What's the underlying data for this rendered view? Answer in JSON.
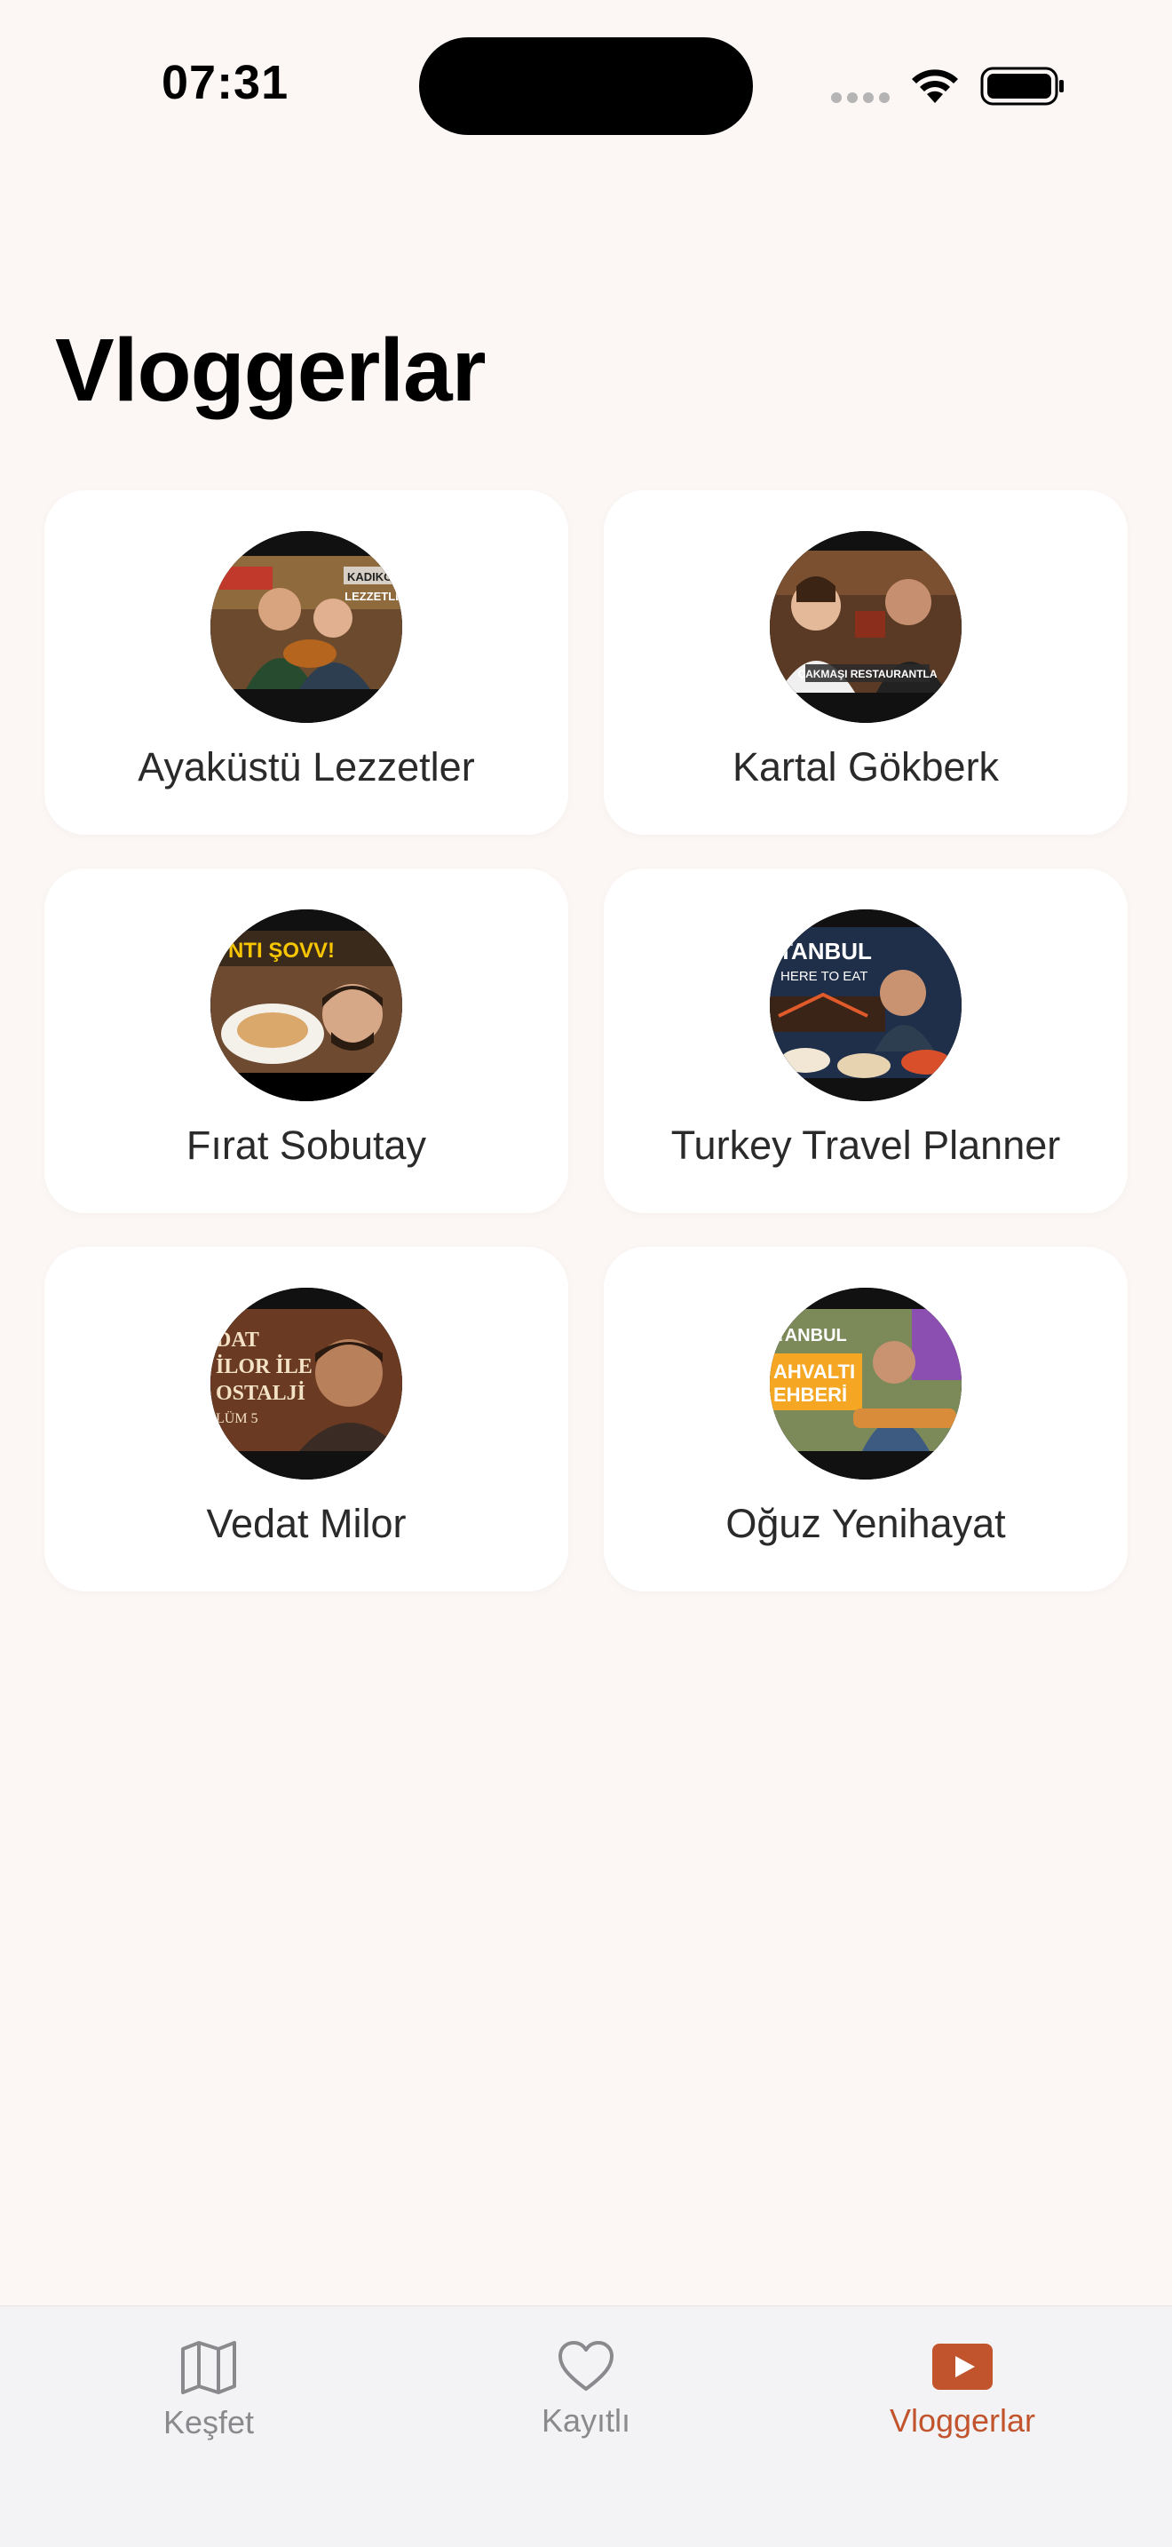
{
  "status_bar": {
    "time": "07:31"
  },
  "page": {
    "title": "Vloggerlar"
  },
  "vloggers": [
    {
      "name": "Ayaküstü Lezzetler",
      "thumb_text": "KADIKÖY LEZZETLER"
    },
    {
      "name": "Kartal Gökberk",
      "thumb_text": "ÇAKMAŞI RESTAURANTLAR"
    },
    {
      "name": "Fırat Sobutay",
      "thumb_text": "NTI ŞOVV!"
    },
    {
      "name": "Turkey Travel Planner",
      "thumb_text": "TANBUL HERE TO EAT"
    },
    {
      "name": "Vedat Milor",
      "thumb_text": "DAT İLOR İLE OSTALJİ LÜM 5"
    },
    {
      "name": "Oğuz Yenihayat",
      "thumb_text": "TANBUL AHVALTI EHBERİ"
    }
  ],
  "tabbar": {
    "tabs": [
      {
        "label": "Keşfet",
        "icon": "map-icon",
        "active": false
      },
      {
        "label": "Kayıtlı",
        "icon": "heart-icon",
        "active": false
      },
      {
        "label": "Vloggerlar",
        "icon": "play-icon",
        "active": true
      }
    ]
  },
  "colors": {
    "accent": "#C2542D",
    "background": "#FCF7F4",
    "card": "#FFFFFF",
    "inactive": "#8A8A8E"
  }
}
